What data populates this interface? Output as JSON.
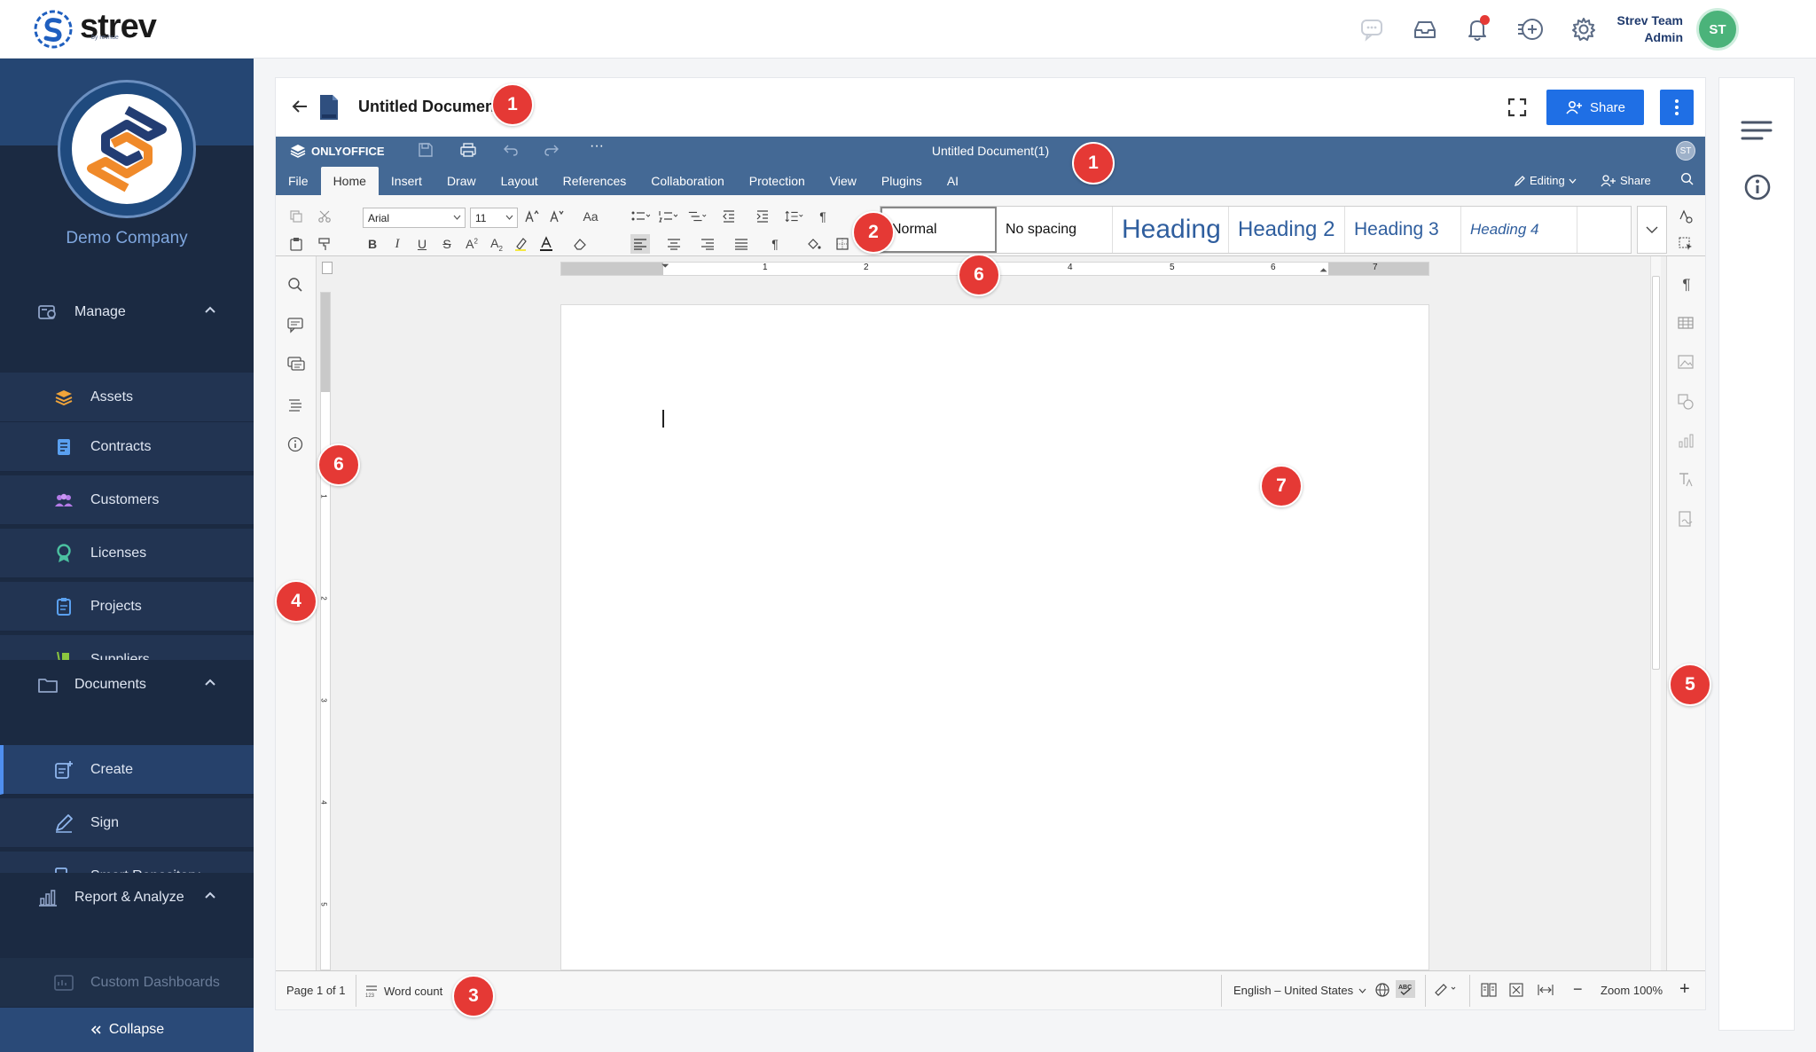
{
  "app": {
    "logo_text": "strev",
    "logo_sub": "by revnue",
    "user_name": "Strev Team",
    "user_role": "Admin",
    "user_initials": "ST"
  },
  "sidebar": {
    "company": "Demo Company",
    "sections": [
      {
        "label": "Manage",
        "items": [
          "Assets",
          "Contracts",
          "Customers",
          "Licenses",
          "Projects",
          "Suppliers"
        ]
      },
      {
        "label": "Documents",
        "items": [
          "Create",
          "Sign",
          "Smart Repository"
        ]
      },
      {
        "label": "Report & Analyze",
        "items": [
          "Custom Dashboards"
        ]
      }
    ],
    "collapse": "Collapse"
  },
  "document": {
    "title": "Untitled Document",
    "share_label": "Share"
  },
  "editor": {
    "brand": "ONLYOFFICE",
    "doc_title": "Untitled Document(1)",
    "avatar": "ST",
    "tabs": [
      "File",
      "Home",
      "Insert",
      "Draw",
      "Layout",
      "References",
      "Collaboration",
      "Protection",
      "View",
      "Plugins",
      "AI"
    ],
    "active_tab": "Home",
    "editing_label": "Editing",
    "share_label": "Share",
    "font_name": "Arial",
    "font_size": "11",
    "case_label": "Aa",
    "styles": [
      "Normal",
      "No spacing",
      "Heading",
      "Heading 2",
      "Heading 3",
      "Heading 4"
    ],
    "ruler_numbers": [
      "1",
      "2",
      "3",
      "4",
      "5",
      "6",
      "7"
    ],
    "vruler_numbers": [
      "1",
      "2",
      "3",
      "4",
      "5"
    ],
    "status": {
      "page": "Page 1 of 1",
      "word_count": "Word count",
      "language": "English – United States",
      "zoom": "Zoom 100%"
    }
  },
  "markers": [
    "1",
    "1",
    "2",
    "6",
    "6",
    "4",
    "7",
    "5",
    "3"
  ],
  "colors": {
    "sidebar_bg": "#1b2a42",
    "accent": "#1f6fe5",
    "editor_header": "#446995",
    "marker": "#e53935",
    "avatar": "#4bb37a"
  }
}
